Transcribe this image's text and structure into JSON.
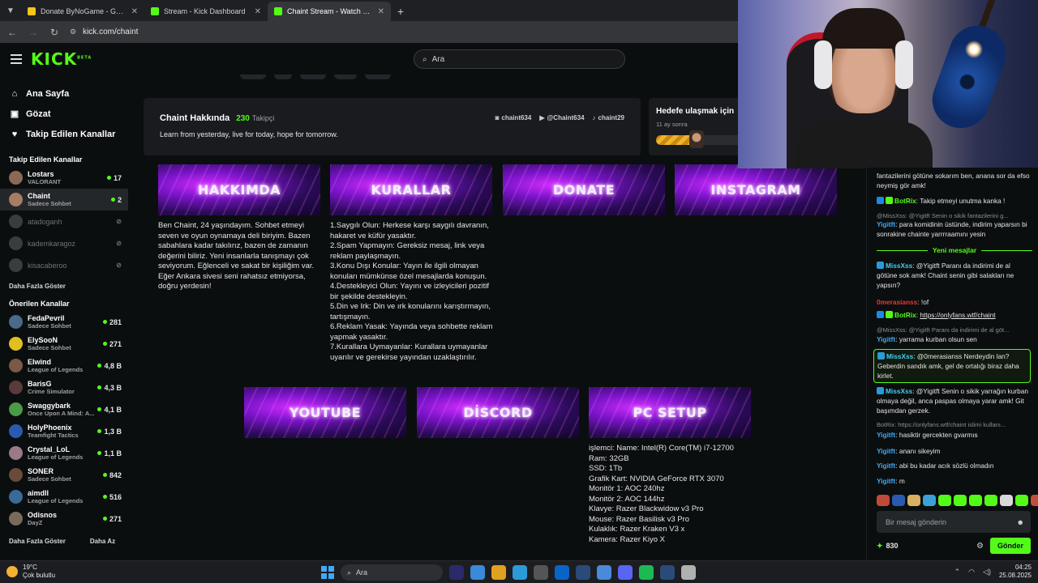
{
  "browser": {
    "tabs": [
      {
        "title": "Donate ByNoGame - Gelen/Gid",
        "favicon_color": "#f5c518",
        "active": false
      },
      {
        "title": "Stream - Kick Dashboard",
        "favicon_color": "#53fc18",
        "active": false
      },
      {
        "title": "Chaint Stream - Watch Live on K",
        "favicon_color": "#53fc18",
        "active": true
      }
    ],
    "url": "kick.com/chaint"
  },
  "kick": {
    "logo": "KICK",
    "logo_suffix": "BETA",
    "search_placeholder": "Ara",
    "accent": "#53fc18"
  },
  "sidebar": {
    "nav": [
      {
        "label": "Ana Sayfa",
        "icon": "home-icon"
      },
      {
        "label": "Gözat",
        "icon": "browse-icon"
      },
      {
        "label": "Takip Edilen Kanallar",
        "icon": "heart-icon"
      }
    ],
    "followed_title": "Takip Edilen Kanallar",
    "followed": [
      {
        "name": "Lostars",
        "category": "VALORANT",
        "viewers": "17",
        "online": true,
        "color": "#8a6a55"
      },
      {
        "name": "Chaint",
        "category": "Sadece Sohbet",
        "viewers": "2",
        "online": true,
        "color": "#a57c64"
      },
      {
        "name": "atadoganh",
        "category": "",
        "viewers": "",
        "online": false,
        "color": "#3a3d40"
      },
      {
        "name": "kademkaragoz",
        "category": "",
        "viewers": "",
        "online": false,
        "color": "#3a3d40"
      },
      {
        "name": "kisacaberoo",
        "category": "",
        "viewers": "",
        "online": false,
        "color": "#3a3d40"
      }
    ],
    "show_more": "Daha Fazla Göster",
    "recommended_title": "Önerilen Kanallar",
    "recommended": [
      {
        "name": "FedaPevril",
        "category": "Sadece Sohbet",
        "viewers": "281",
        "color": "#4a6a8a"
      },
      {
        "name": "ElySooN",
        "category": "Sadece Sohbet",
        "viewers": "271",
        "color": "#e0c020"
      },
      {
        "name": "Elwind",
        "category": "League of Legends",
        "viewers": "4,8 B",
        "color": "#7a5a44"
      },
      {
        "name": "BarisG",
        "category": "Crime Simulator",
        "viewers": "4,3 B",
        "color": "#5a3a3a"
      },
      {
        "name": "Swaggybark",
        "category": "Once Upon A Mind: A...",
        "viewers": "4,1 B",
        "color": "#4a9a4a"
      },
      {
        "name": "HolyPhoenix",
        "category": "Teamfight Tactics",
        "viewers": "1,3 B",
        "color": "#2a5ab0"
      },
      {
        "name": "Crystal_LoL",
        "category": "League of Legends",
        "viewers": "1,1 B",
        "color": "#9a7a8a"
      },
      {
        "name": "SONER",
        "category": "Sadece Sohbet",
        "viewers": "842",
        "color": "#6a4a3a"
      },
      {
        "name": "aimdll",
        "category": "League of Legends",
        "viewers": "516",
        "color": "#3a6a9a"
      },
      {
        "name": "Odisnos",
        "category": "DayZ",
        "viewers": "271",
        "color": "#7a6a5a"
      }
    ],
    "show_more_2": "Daha Fazla Göster",
    "show_less": "Daha Az"
  },
  "about": {
    "title": "Chaint Hakkında",
    "followers": "230",
    "followers_label": "Takipçi",
    "bio": "Learn from yesterday, live for today, hope for tomorrow.",
    "socials": [
      {
        "icon": "instagram-icon",
        "handle": "chaint634"
      },
      {
        "icon": "youtube-icon",
        "handle": "@Chaint634"
      },
      {
        "icon": "tiktok-icon",
        "handle": "chaint29"
      }
    ]
  },
  "goal": {
    "title": "Hedefe ulaşmak için",
    "subtitle": "11 ay sonra",
    "progress": 0.45
  },
  "panels": {
    "row1": [
      "HAKKIMDA",
      "KURALLAR",
      "DONATE",
      "INSTAGRAM"
    ],
    "row2": [
      "YOUTUBE",
      "DİSCORD",
      "PC SETUP"
    ],
    "hakkimda_text": "Ben Chaint, 24 yaşındayım. Sohbet etmeyi seven ve oyun oynamaya deli biriyim. Bazen sabahlara kadar takılırız, bazen de zamanın değerini biliriz. Yeni insanlarla tanışmayı çok seviyorum. Eğlenceli ve sakat bir kişiliğim var. Eğer Ankara sivesi seni rahatsız etmiyorsa, doğru yerdesin!",
    "kurallar_text": "1.Saygılı Olun: Herkese karşı saygılı davranın, hakaret ve küfür yasaktır.\n2.Spam Yapmayın: Gereksiz mesaj, link veya reklam paylaşmayın.\n3.Konu Dışı Konular: Yayın ile ilgili olmayan konuları mümkünse özel mesajlarda konuşun.\n4.Destekleyici Olun: Yayını ve izleyicileri pozitif bir şekilde destekleyin.\n5.Din ve Irk: Din ve ırk konularını karıştırmayın, tartışmayın.\n6.Reklam Yasak: Yayında veya sohbette reklam yapmak yasaktır.\n7.Kurallara Uymayanlar: Kurallara uymayanlar uyarılır ve gerekirse yayından uzaklaştırılır.",
    "pc_text": "işlemci: Name: Intel(R) Core(TM) i7-12700\nRam: 32GB\nSSD: 1Tb\nGrafik Kart: NVIDIA GeForce RTX 3070\nMonitör 1: AOC 240hz\nMonitör 2: AOC 144hz\nKlavye: Razer Blackwidow v3 Pro\nMouse: Razer Basilisk v3 Pro\nKulaklık: Razer Kraken V3 x\nKamera: Razer Kiyo X"
  },
  "chat": {
    "messages": [
      {
        "kind": "text",
        "text": "fantazilerini götüne sokarım ben, anana sor da efso neymiş gör amk!"
      },
      {
        "kind": "msg",
        "user": "BotRix",
        "user_color": "#53fc18",
        "badges": [
          "#1e88e5",
          "#53fc18"
        ],
        "text": "Takip etmeyi unutma kanka !"
      },
      {
        "kind": "reply",
        "text": "@MissXss: @Yigitft Senin o sikik fantazilerini g..."
      },
      {
        "kind": "msg",
        "user": "Yigitft",
        "user_color": "#3fa9f5",
        "badges": [],
        "text": "para komidinin üstünde, indirim yaparsın bi sonrakine chainte yarrrraamını yesin"
      },
      {
        "kind": "msg",
        "user": "MissXss",
        "user_color": "#3fd0f5",
        "badges": [
          "#2a9bd8"
        ],
        "text": "@Yigitft Paranı da indirimi de al götüne sok amk! Chaint senin gibi salakları ne yapsın?"
      },
      {
        "kind": "msg",
        "user": "0merasianss",
        "user_color": "#e53935",
        "badges": [],
        "text": "!of"
      },
      {
        "kind": "msg",
        "user": "BotRix",
        "user_color": "#53fc18",
        "badges": [
          "#1e88e5",
          "#53fc18"
        ],
        "text": "https://onlyfans.wtf/chaint",
        "link": true
      },
      {
        "kind": "reply",
        "text": "@MissXss: @Yigitft Paranı da indirimi de al göt..."
      },
      {
        "kind": "msg",
        "user": "Yigitft",
        "user_color": "#3fa9f5",
        "badges": [],
        "text": "yarrama kurban olsun sen"
      },
      {
        "kind": "msg",
        "user": "MissXss",
        "user_color": "#3fd0f5",
        "badges": [
          "#2a9bd8"
        ],
        "text": "@0merasianss Nerdeydin lan? Geberdin sandık amk, gel de ortalığı biraz daha kirlet.",
        "highlight": true
      },
      {
        "kind": "msg",
        "user": "MissXss",
        "user_color": "#3fd0f5",
        "badges": [
          "#2a9bd8"
        ],
        "text": "@Yigitft Senin o sikik yarrağın kurban olmaya değil, anca paspas olmaya yarar amk! Git başımdan gerzek."
      },
      {
        "kind": "reply",
        "text": "BotRix: https://onlyfans.wtf/chaint islimi kullanı..."
      },
      {
        "kind": "msg",
        "user": "Yigitft",
        "user_color": "#3fa9f5",
        "badges": [],
        "text": "hasiktir gercekten gvarmıs"
      },
      {
        "kind": "msg",
        "user": "Yigitft",
        "user_color": "#3fa9f5",
        "badges": [],
        "text": "ananı sikeyim"
      },
      {
        "kind": "msg",
        "user": "Yigitft",
        "user_color": "#3fa9f5",
        "badges": [],
        "text": "abi bu kadar acık sözlü olmadın"
      },
      {
        "kind": "msg",
        "user": "Yigitft",
        "user_color": "#3fa9f5",
        "badges": [],
        "text": "m"
      }
    ],
    "new_messages_label": "Yeni mesajlar",
    "input_placeholder": "Bir mesaj gönderin",
    "points": "830",
    "send_label": "Gönder",
    "emote_colors": [
      "#c04a3a",
      "#2a5ab0",
      "#d8b060",
      "#3aa0d8",
      "#53fc18",
      "#53fc18",
      "#53fc18",
      "#53fc18",
      "#d8d8d8",
      "#53fc18",
      "#c0503a",
      "#53fc18"
    ]
  },
  "taskbar": {
    "temperature": "19°C",
    "weather": "Çok bulutlu",
    "search": "Ara",
    "time": "04:25",
    "date": "25.08.2025",
    "apps": [
      "#2a2a6a",
      "#3a8ad8",
      "#e0a020",
      "#2a9bd8",
      "#555",
      "#0a64c8",
      "#2a4a7a",
      "#4a8ad8",
      "#5865f2",
      "#1db954",
      "#2a4a7a",
      "#b0b0b0"
    ]
  }
}
